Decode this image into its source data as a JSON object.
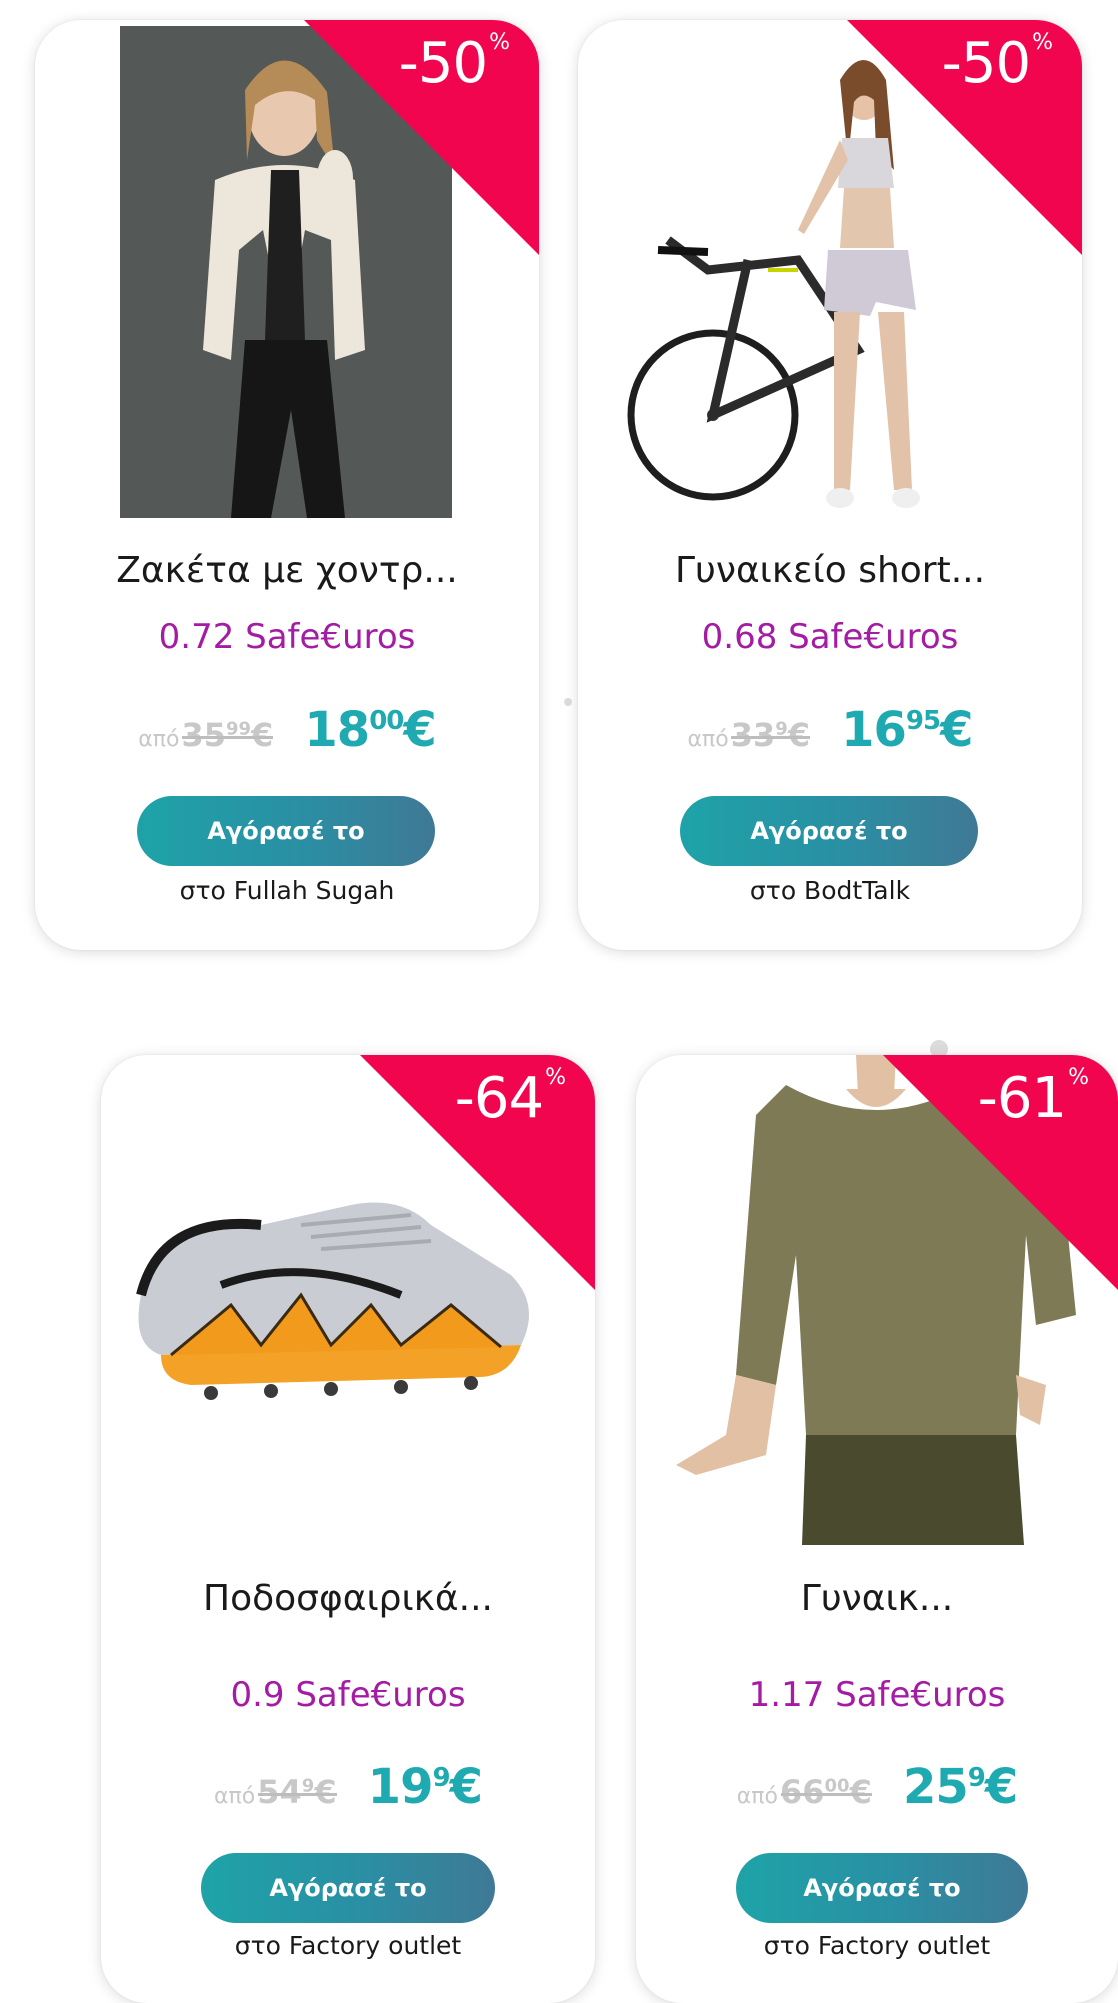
{
  "products": [
    {
      "discount": "-50",
      "discount_symbol": "%",
      "title": "Ζακέτα με χοντρ...",
      "safeuros": "0.72 Safe€uros",
      "old_prefix": "από",
      "old_main": "35",
      "old_cents": "99",
      "old_currency": "€",
      "new_main": "18",
      "new_cents": "00",
      "new_currency": "€",
      "buy_label": "Αγόρασέ το",
      "store": "στο Fullah Sugah",
      "image_icon": "woman-white-cardigan-photo"
    },
    {
      "discount": "-50",
      "discount_symbol": "%",
      "title": "Γυναικείο short...",
      "safeuros": "0.68 Safe€uros",
      "old_prefix": "από",
      "old_main": "33",
      "old_cents": "9",
      "old_currency": "€",
      "new_main": "16",
      "new_cents": "95",
      "new_currency": "€",
      "buy_label": "Αγόρασέ το",
      "store": "στο BodtTalk",
      "image_icon": "woman-shorts-bicycle-photo"
    },
    {
      "discount": "-64",
      "discount_symbol": "%",
      "title": "Ποδοσφαιρικά...",
      "safeuros": "0.9 Safe€uros",
      "old_prefix": "από",
      "old_main": "54",
      "old_cents": "9",
      "old_currency": "€",
      "new_main": "19",
      "new_cents": "9",
      "new_currency": "€",
      "buy_label": "Αγόρασέ το",
      "store": "στο Factory outlet",
      "image_icon": "football-boot-photo"
    },
    {
      "discount": "-61",
      "discount_symbol": "%",
      "title": "Γυναικ...",
      "safeuros": "1.17 Safe€uros",
      "old_prefix": "από",
      "old_main": "66",
      "old_cents": "00",
      "old_currency": "€",
      "new_main": "25",
      "new_cents": "9",
      "new_currency": "€",
      "buy_label": "Αγόρασέ το",
      "store": "στο Factory outlet",
      "image_icon": "woman-olive-tshirt-photo"
    }
  ],
  "colors": {
    "ribbon": "#f2054f",
    "safeuros": "#a41ca4",
    "price_new": "#1eaab0",
    "button_start": "#1ea3a8",
    "button_end": "#3f7995"
  }
}
